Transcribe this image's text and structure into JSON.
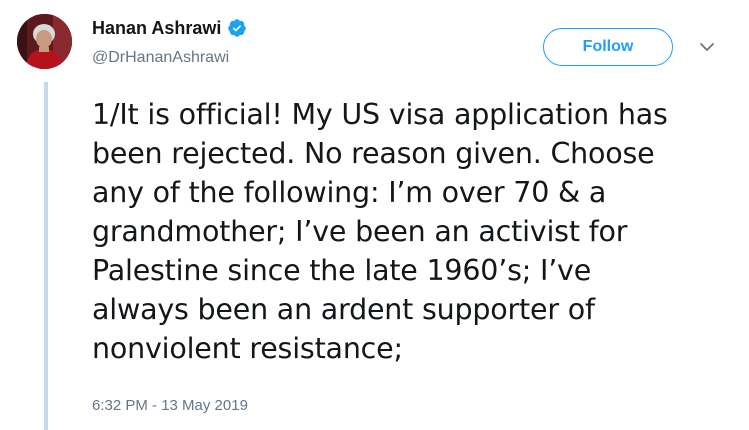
{
  "user": {
    "display_name": "Hanan Ashrawi",
    "handle": "@DrHananAshrawi",
    "verified": true,
    "avatar_icon": "profile-photo"
  },
  "actions": {
    "follow_label": "Follow",
    "menu_icon": "chevron-down-icon"
  },
  "tweet": {
    "text": "1/It is official! My US visa application has\nbeen rejected. No reason given. Choose\nany of the following: I’m over 70 & a\ngrandmother; I’ve been an activist for\nPalestine since the late 1960’s; I’ve\nalways been an ardent supporter of\nnonviolent resistance;",
    "timestamp": "6:32 PM - 13 May 2019"
  },
  "colors": {
    "accent": "#1da1f2",
    "thread_line": "#c4d9ec",
    "secondary_text": "#657786",
    "primary_text": "#14171a"
  }
}
